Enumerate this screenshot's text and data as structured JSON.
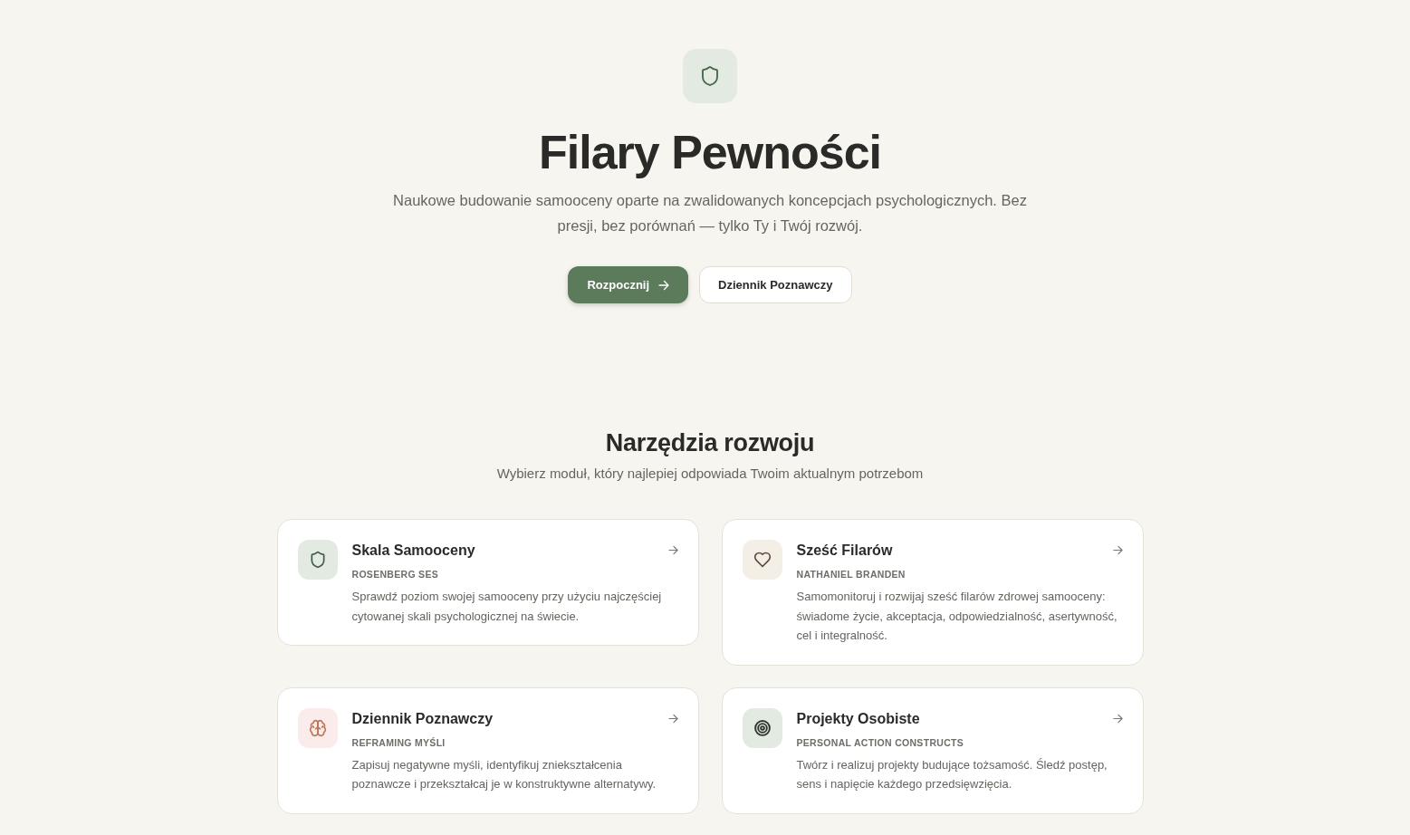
{
  "hero": {
    "title": "Filary Pewności",
    "subtitle": "Naukowe budowanie samooceny oparte na zwalidowanych koncepcjach psychologicznych. Bez presji, bez porównań — tylko Ty i Twój rozwój.",
    "buttons": [
      {
        "label": "Rozpocznij",
        "kind": "primary"
      },
      {
        "label": "Dziennik Poznawczy",
        "kind": "secondary"
      }
    ]
  },
  "section": {
    "title": "Narzędzia rozwoju",
    "subtitle": "Wybierz moduł, który najlepiej odpowiada Twoim aktualnym potrzebom"
  },
  "cards": [
    {
      "kind": "shield",
      "color": "#e3eae2",
      "title": "Skala Samooceny",
      "tag": "ROSENBERG SES",
      "description": "Sprawdź poziom swojej samooceny przy użyciu najczęściej cytowanej skali psychologicznej na świecie."
    },
    {
      "kind": "heart",
      "color": "#f3eee6",
      "title": "Sześć Filarów",
      "tag": "NATHANIEL BRANDEN",
      "description": "Samomonitoruj i rozwijaj sześć filarów zdrowej samooceny: świadome życie, akceptacja, odpowiedzialność, asertywność, cel i integralność."
    },
    {
      "kind": "brain",
      "color": "#f9ecea",
      "title": "Dziennik Poznawczy",
      "tag": "REFRAMING MYŚLI",
      "description": "Zapisuj negatywne myśli, identyfikuj zniekształcenia poznawcze i przekształcaj je w konstruktywne alternatywy."
    },
    {
      "kind": "target",
      "color": "#e3eae2",
      "title": "Projekty Osobiste",
      "tag": "PERSONAL ACTION CONSTRUCTS",
      "description": "Twórz i realizuj projekty budujące tożsamość. Śledź postęp, sens i napięcie każdego przedsięwzięcia."
    }
  ]
}
